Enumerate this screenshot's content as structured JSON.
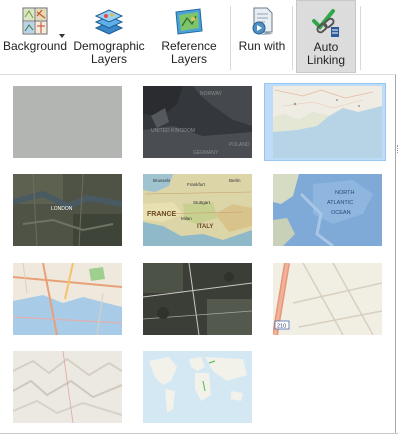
{
  "ribbon": {
    "background": {
      "label": "Background",
      "icon": "basemap-grid-icon",
      "has_dropdown": true
    },
    "demographic_layers": {
      "label_line1": "Demographic",
      "label_line2": "Layers",
      "icon": "layers-stack-icon"
    },
    "reference_layers": {
      "label_line1": "Reference",
      "label_line2": "Layers",
      "icon": "map-layer-icon"
    },
    "run_with": {
      "label": "Run with",
      "icon": "document-run-icon"
    },
    "auto_linking": {
      "label_line1": "Auto",
      "label_line2": "Linking",
      "icon": "chain-link-check-icon",
      "pressed": true
    }
  },
  "gallery": {
    "items": [
      {
        "id": "light-gray",
        "labels": []
      },
      {
        "id": "dark-gray",
        "labels": [
          "NORWAY",
          "UNITED KINGDOM",
          "POLAND",
          "GERMANY"
        ]
      },
      {
        "id": "topographic",
        "selected": true,
        "labels": []
      },
      {
        "id": "imagery",
        "labels": [
          "LONDON"
        ]
      },
      {
        "id": "national-geographic",
        "labels": [
          "FRANCE",
          "ITALY",
          "Frankfurt",
          "Stuttgart",
          "Brussels",
          "Berlin",
          "Milan"
        ]
      },
      {
        "id": "oceans",
        "labels": [
          "NORTH",
          "ATLANTIC",
          "OCEAN"
        ]
      },
      {
        "id": "streets",
        "labels": []
      },
      {
        "id": "imagery-hybrid",
        "labels": []
      },
      {
        "id": "openstreetmap",
        "labels": [
          "210"
        ]
      },
      {
        "id": "terrain",
        "labels": []
      },
      {
        "id": "world-oceans-light",
        "labels": []
      }
    ]
  },
  "colors": {
    "selection": "#bcdcf8",
    "ribbon_pressed": "#dcdcdc"
  }
}
